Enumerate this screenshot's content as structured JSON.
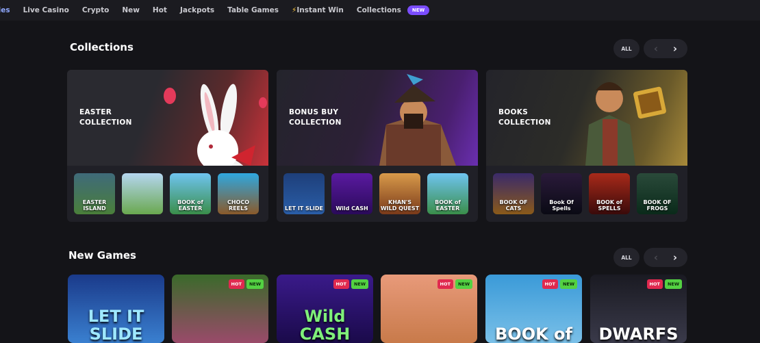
{
  "nav": {
    "items": [
      "lies",
      "Live Casino",
      "Crypto",
      "New",
      "Hot",
      "Jackpots",
      "Table Games",
      "Instant Win",
      "Collections"
    ],
    "instant_win_icon": "lightning-bolt-icon",
    "new_badge": "NEW"
  },
  "collections": {
    "title": "Collections",
    "all_label": "ALL",
    "cards": [
      {
        "title_line1": "EASTER",
        "title_line2": "COLLECTION",
        "accent": "#c9323a",
        "thumbs": [
          "EASTER ISLAND",
          "",
          "BOOK of EASTER",
          "CHOCO REELS"
        ]
      },
      {
        "title_line1": "BONUS BUY",
        "title_line2": "COLLECTION",
        "accent": "#6a2fb0",
        "thumbs": [
          "LET IT SLIDE",
          "Wild CASH",
          "KHAN'S WILD QUEST",
          "BOOK of EASTER"
        ]
      },
      {
        "title_line1": "BOOKS",
        "title_line2": "COLLECTION",
        "accent": "#d4a23a",
        "thumbs": [
          "BOOK OF CATS",
          "Book Of Spells",
          "BOOK of SPELLS",
          "BOOK OF FROGS"
        ]
      }
    ]
  },
  "new_games": {
    "title": "New Games",
    "all_label": "ALL",
    "hot_label": "HOT",
    "new_label": "NEW",
    "games": [
      "LET IT SLIDE",
      "",
      "Wild CASH",
      "",
      "BOOK of",
      "DWARFS"
    ]
  }
}
